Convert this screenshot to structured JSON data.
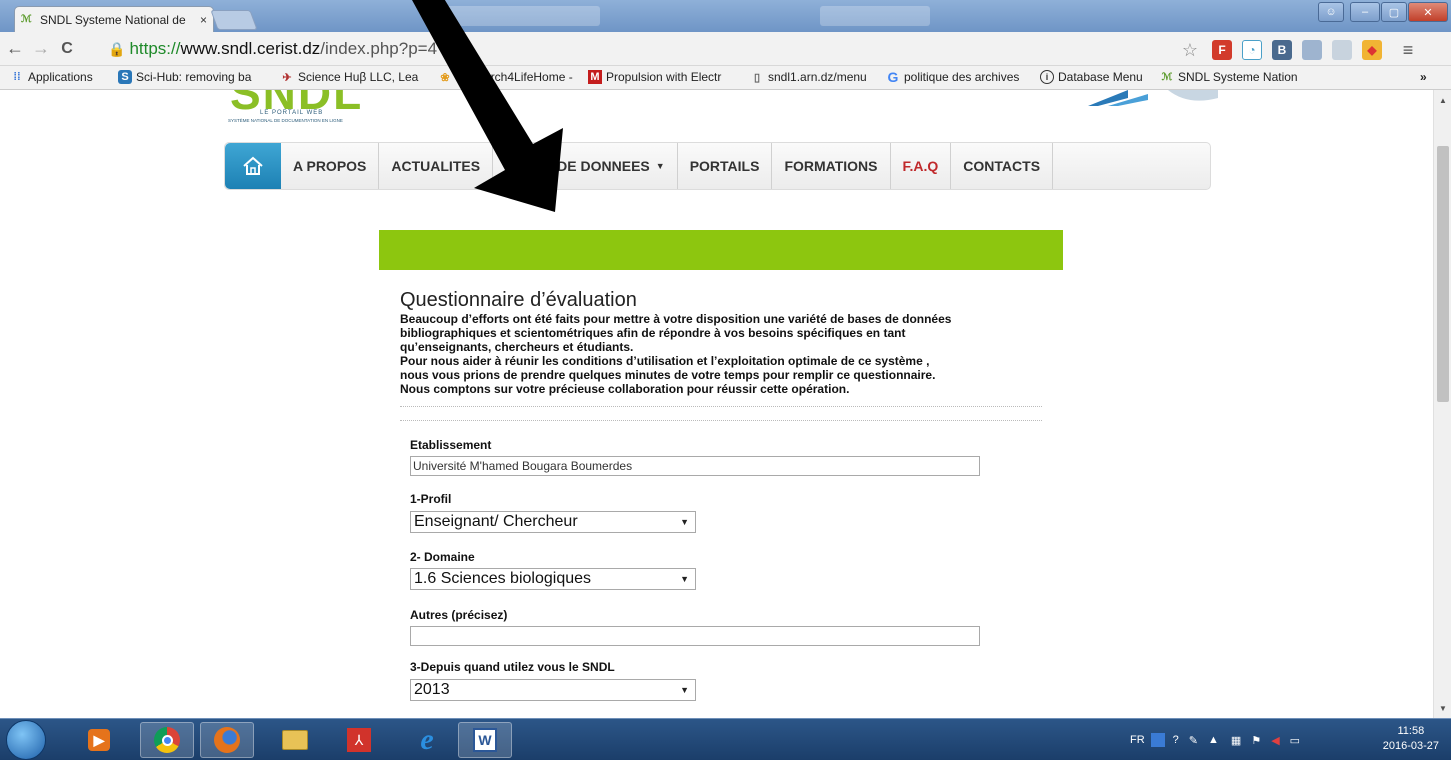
{
  "browser": {
    "tab_title": "SNDL Systeme National de",
    "tab_close": "×",
    "url_secure": "https://",
    "url_host": "www.sndl.cerist.dz",
    "url_path": "/index.php?p=4",
    "back": "←",
    "forward": "→",
    "reload": "C",
    "star": "☆",
    "menu": "≡"
  },
  "bookmarks": [
    {
      "label": "Applications",
      "icon": "apps-icon"
    },
    {
      "label": "Sci-Hub: removing ba",
      "icon": "scihub-icon"
    },
    {
      "label": "Science Huβ LLC, Lea",
      "icon": "sciencehub-icon"
    },
    {
      "label": "Research4LifeHome -",
      "icon": "research4life-icon"
    },
    {
      "label": "Propulsion with Electr",
      "icon": "mendeley-icon"
    },
    {
      "label": "sndl1.arn.dz/menu",
      "icon": "page-icon"
    },
    {
      "label": "politique des archives",
      "icon": "google-icon"
    },
    {
      "label": "Database Menu",
      "icon": "info-icon"
    },
    {
      "label": "SNDL Systeme Nation",
      "icon": "sndl-icon"
    }
  ],
  "bookmarks_more": "»",
  "site": {
    "logo_text": "SNDL",
    "logo_sub": "LE PORTAIL WEB",
    "logo_sub2": "SYSTÈME NATIONAL DE DOCUMENTATION EN LIGNE",
    "nav": [
      {
        "label": "A PROPOS"
      },
      {
        "label": "ACTUALITES"
      },
      {
        "label": "BASES DE DONNEES",
        "caret": "▼"
      },
      {
        "label": "PORTAILS"
      },
      {
        "label": "FORMATIONS"
      },
      {
        "label": "F.A.Q"
      },
      {
        "label": "CONTACTS"
      }
    ]
  },
  "form": {
    "title": "Questionnaire d’évaluation",
    "intro": [
      "Beaucoup d’efforts ont été faits pour mettre à votre disposition une variété de bases de données",
      "bibliographiques et scientométriques afin de répondre à vos besoins spécifiques en tant",
      "qu’enseignants, chercheurs et étudiants.",
      "Pour nous aider à réunir les conditions d’utilisation et l’exploitation optimale de ce système ,",
      "nous vous prions de prendre quelques minutes de votre temps pour remplir ce questionnaire.",
      "Nous comptons sur votre précieuse collaboration pour réussir cette opération."
    ],
    "etablissement_label": "Etablissement",
    "etablissement_value": "Université M'hamed Bougara Boumerdes",
    "profil_label": "1-Profil",
    "profil_value": "Enseignant/ Chercheur",
    "domaine_label": "2- Domaine",
    "domaine_value": "1.6 Sciences biologiques",
    "autres_label": "Autres (précisez)",
    "autres_value": "",
    "depuis_label": "3-Depuis quand utilez vous le SNDL",
    "depuis_value": "2013",
    "select_arrow": "▼"
  },
  "taskbar": {
    "lang": "FR",
    "time": "11:58",
    "date": "2016-03-27"
  },
  "colors": {
    "green_bar": "#8dc60f",
    "faq_red": "#c0292b",
    "home_blue": "#1d81b4",
    "url_green": "#1f8a2a"
  }
}
